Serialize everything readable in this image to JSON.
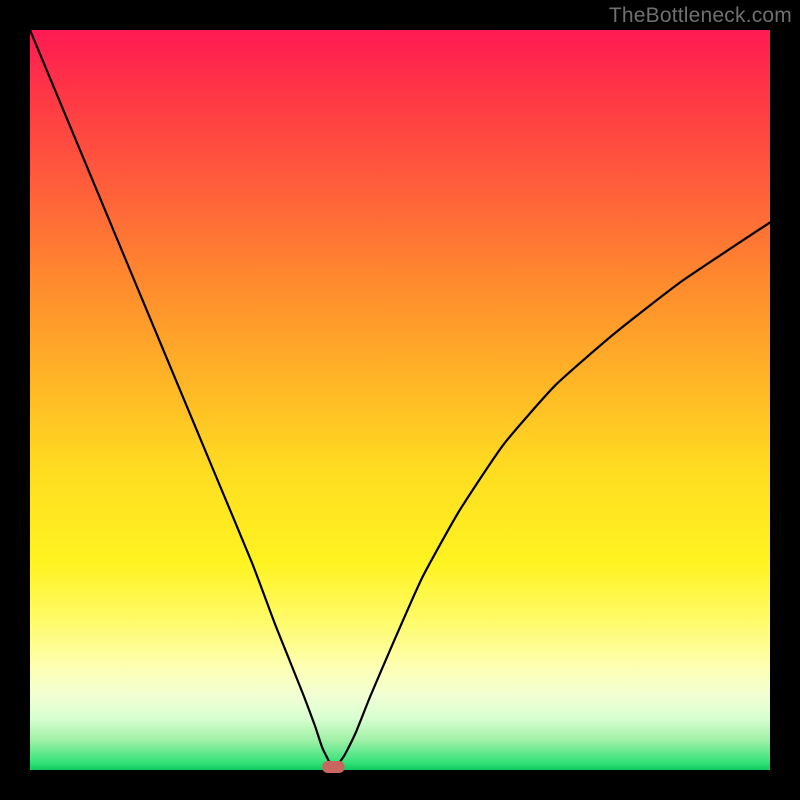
{
  "watermark": {
    "text": "TheBottleneck.com"
  },
  "colors": {
    "frame": "#000000",
    "curve": "#000000",
    "marker_fill": "#c9675f",
    "gradient_top": "#ff1a53",
    "gradient_bottom": "#10c95f"
  },
  "chart_data": {
    "type": "line",
    "title": "",
    "xlabel": "",
    "ylabel": "",
    "xlim": [
      0,
      100
    ],
    "ylim": [
      0,
      100
    ],
    "grid": false,
    "legend": false,
    "annotations": [],
    "marker": {
      "x": 41,
      "y": 0,
      "shape": "rounded-rect"
    },
    "series": [
      {
        "name": "bottleneck-curve",
        "x": [
          0,
          5,
          10,
          15,
          20,
          25,
          30,
          33,
          35,
          37,
          38.5,
          39.5,
          40.5,
          41,
          42.5,
          44,
          46,
          49,
          53,
          58,
          64,
          71,
          79,
          88,
          100
        ],
        "y": [
          100,
          88,
          76,
          64,
          52,
          40,
          28,
          20,
          15,
          10,
          6,
          3,
          1,
          0,
          2,
          5,
          10,
          17,
          26,
          35,
          44,
          52,
          59,
          66,
          74
        ]
      }
    ]
  }
}
